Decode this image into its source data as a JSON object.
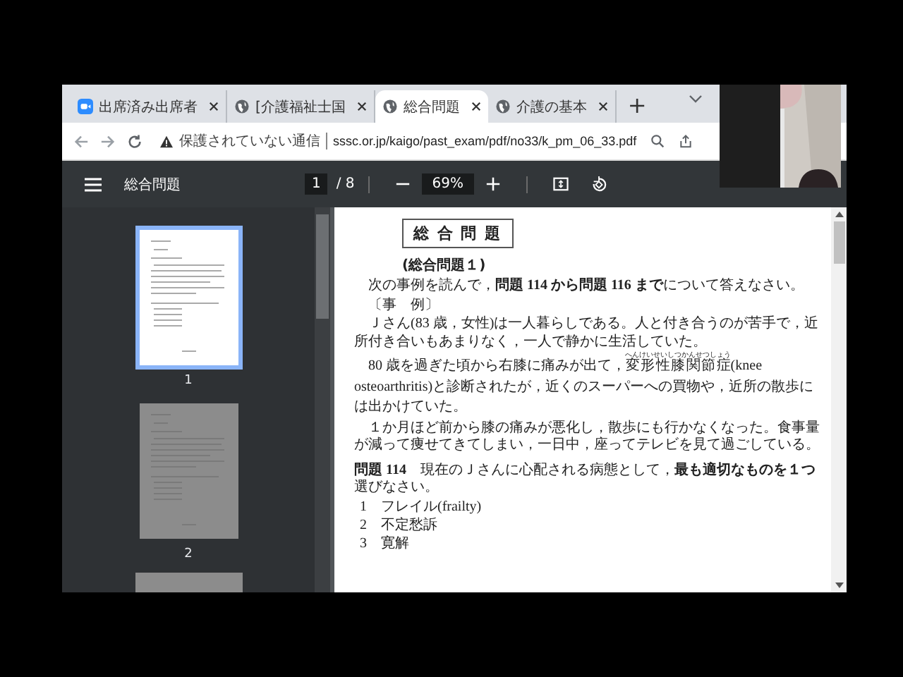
{
  "tabs": [
    {
      "label": "出席済み出席者",
      "selected": false
    },
    {
      "label": "[介護福祉士国",
      "selected": false
    },
    {
      "label": "総合問題",
      "selected": true
    },
    {
      "label": "介護の基本",
      "selected": false
    }
  ],
  "new_tab": "+",
  "address_bar": {
    "security": "保護されていない通信",
    "url": "sssc.or.jp/kaigo/past_exam/pdf/no33/k_pm_06_33.pdf"
  },
  "pdf_toolbar": {
    "title": "総合問題",
    "page": "1",
    "page_count": "/ 8",
    "zoom": "69%"
  },
  "thumbnails": [
    {
      "label": "1",
      "selected": true
    },
    {
      "label": "2",
      "selected": false
    }
  ],
  "document": {
    "title": "総 合 問 題",
    "heading": "(総合問題１)",
    "paragraphs": [
      {
        "kind": "text",
        "text": "次の事例を読んで，**問題 114 から問題 116 まで**について答えなさい。"
      },
      {
        "kind": "text",
        "text": "〔事　例〕"
      },
      {
        "kind": "text",
        "text": "Ｊさん(83 歳，女性)は一人暮らしである。人と付き合うのが苦手で，近所付き合いもあまりなく，一人で静かに生活していた。"
      },
      {
        "kind": "ruby",
        "before": "80 歳を過ぎた頃から右膝に痛みが出て，",
        "base": "変形性膝関節症",
        "ruby": "へんけいせいしつかんせつしょう",
        "after": "(knee osteoarthritis)と診断されたが，近くのスーパーへの買物や，近所の散歩には出かけていた。"
      },
      {
        "kind": "text",
        "text": "１か月ほど前から膝の痛みが悪化し，散歩にも行かなくなった。食事量が減って痩せてきてしまい，一日中，座ってテレビを見て過ごしている。"
      }
    ],
    "question": "**問題 114**　現在のＪさんに心配される病態として，**最も適切なものを１つ**選びなさい。",
    "options": [
      "1　フレイル(frailty)",
      "2　不定愁訴",
      "3　寛解"
    ]
  }
}
